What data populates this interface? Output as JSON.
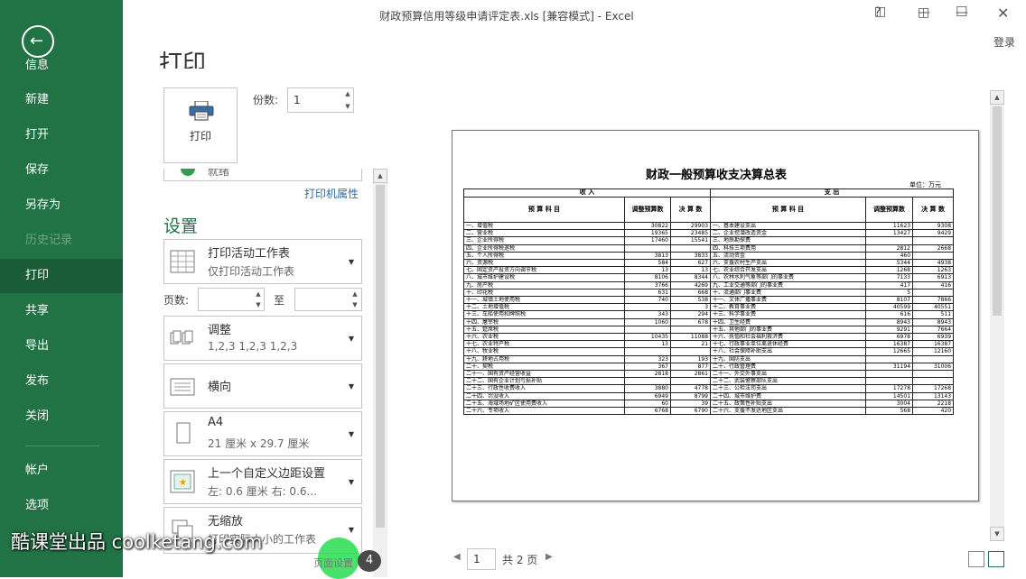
{
  "window": {
    "title": "财政预算信用等级申请评定表.xls  [兼容模式] - Excel",
    "help": "?",
    "login": "登录"
  },
  "sidebar": {
    "items": [
      {
        "label": "信息"
      },
      {
        "label": "新建"
      },
      {
        "label": "打开"
      },
      {
        "label": "保存"
      },
      {
        "label": "另存为"
      },
      {
        "label": "历史记录"
      },
      {
        "label": "打印"
      },
      {
        "label": "共享"
      },
      {
        "label": "导出"
      },
      {
        "label": "发布"
      },
      {
        "label": "关闭"
      },
      {
        "label": "帐户"
      },
      {
        "label": "选项"
      }
    ]
  },
  "print": {
    "heading": "打印",
    "button_label": "打印",
    "copies_label": "份数:",
    "copies_value": "1",
    "printer_status": "就绪",
    "printer_properties": "打印机属性"
  },
  "settings": {
    "heading": "设置",
    "active_sheet": {
      "title": "打印活动工作表",
      "subtitle": "仅打印活动工作表"
    },
    "pages_label": "页数:",
    "to_label": "至",
    "collate": {
      "title": "调整",
      "subtitle": "1,2,3    1,2,3    1,2,3"
    },
    "orientation": {
      "title": "横向"
    },
    "paper": {
      "title": "A4",
      "subtitle": "21 厘米 x 29.7 厘米"
    },
    "margins": {
      "title": "上一个自定义边距设置",
      "subtitle": "左: 0.6 厘米    右: 0.6..."
    },
    "scaling": {
      "title": "无缩放",
      "subtitle": "打印实际大小的工作表"
    },
    "page_setup": "页面设置"
  },
  "page_nav": {
    "current": "1",
    "total": "共 2 页"
  },
  "overlay": {
    "watermark": "酷课堂出品 coolketang.com",
    "step": "4"
  },
  "sheet": {
    "title": "财政一般预算收支决算总表",
    "unit": "单位：万元",
    "header_income": "收                    入",
    "header_expense": "支                    出",
    "col_income_item": "预     算     科     目",
    "col_adjusted": "调整预算数",
    "col_final": "决 算 数",
    "col_expense_item": "预     算     科     目",
    "col_adjusted2": "调整预算数",
    "col_final2": "决 算 数",
    "rows": [
      [
        "一、增值税",
        "30822",
        "29903",
        "一、基本建设支出",
        "11623",
        "9308"
      ],
      [
        "二、营业税",
        "19365",
        "23485",
        "二、企业挖潜改造资金",
        "13427",
        "9429"
      ],
      [
        "三、企业所得税",
        "17460",
        "15541",
        "三、地质勘探费",
        "",
        ""
      ],
      [
        "四、企业所得税退税",
        "",
        "",
        "四、科技三项费用",
        "2812",
        "2668"
      ],
      [
        "五、个人所得税",
        "3813",
        "3833",
        "五、流动资金",
        "460",
        ""
      ],
      [
        "六、资源税",
        "584",
        "627",
        "六、支援农村生产支出",
        "5344",
        "4938"
      ],
      [
        "七、固定资产投资方向调节税",
        "13",
        "13",
        "七、农业综合开发支出",
        "1268",
        "1263"
      ],
      [
        "八、城市维护建设税",
        "8106",
        "8344",
        "八、农林水利气象等部门的事业费",
        "7133",
        "6913"
      ],
      [
        "九、房产税",
        "3766",
        "4269",
        "九、工业交通等部门的事业费",
        "417",
        "416"
      ],
      [
        "十、印花税",
        "631",
        "668",
        "十、流通部门事业费",
        "5",
        ""
      ],
      [
        "十一、城镇土地使用税",
        "740",
        "538",
        "十一、文体广播事业费",
        "8107",
        "7866"
      ],
      [
        "十二、土地增值税",
        "",
        "3",
        "十二、教育事业费",
        "40599",
        "40551"
      ],
      [
        "十三、车船使用和牌照税",
        "343",
        "294",
        "十三、科学事业费",
        "616",
        "511"
      ],
      [
        "十四、屠宰税",
        "1060",
        "678",
        "十四、卫生经费",
        "8943",
        "8943"
      ],
      [
        "十五、筵席税",
        "",
        "",
        "十五、其他部门的事业费",
        "9291",
        "7664"
      ],
      [
        "十六、农业税",
        "10435",
        "11088",
        "十六、抚恤和社会福利救济费",
        "6978",
        "6939"
      ],
      [
        "十七、农业特产税",
        "13",
        "21",
        "十七、行政事业单位离退休经费",
        "16387",
        "16387"
      ],
      [
        "十八、牧业税",
        "",
        "",
        "十八、社会保障补助支出",
        "12665",
        "12160"
      ],
      [
        "十九、耕地占用税",
        "323",
        "193",
        "十九、国防支出",
        "",
        ""
      ],
      [
        "二十、契税",
        "367",
        "877",
        "二十、行政管理费",
        "31194",
        "31006"
      ],
      [
        "二十一、国有资产经营收益",
        "2818",
        "2861",
        "二十一、外交外事支出",
        "",
        ""
      ],
      [
        "二十二、国有企业计划亏损补贴",
        "",
        "",
        "二十二、武装警察部队支出",
        "",
        ""
      ],
      [
        "二十三、行政性收费收入",
        "3880",
        "4778",
        "二十三、公检法司支出",
        "17278",
        "17268"
      ],
      [
        "二十四、罚没收入",
        "6949",
        "8799",
        "二十四、城市维护费",
        "14501",
        "13143"
      ],
      [
        "二十五、海域场地矿区使用费收入",
        "60",
        "39",
        "二十五、政策性补贴支出",
        "3004",
        "2218"
      ],
      [
        "二十六、专项收入",
        "6768",
        "6790",
        "二十六、支援不发达地区支出",
        "568",
        "420"
      ]
    ]
  },
  "colors": {
    "brand": "#217346",
    "brand_active": "#1a5c38",
    "link": "#2b6ba5"
  }
}
